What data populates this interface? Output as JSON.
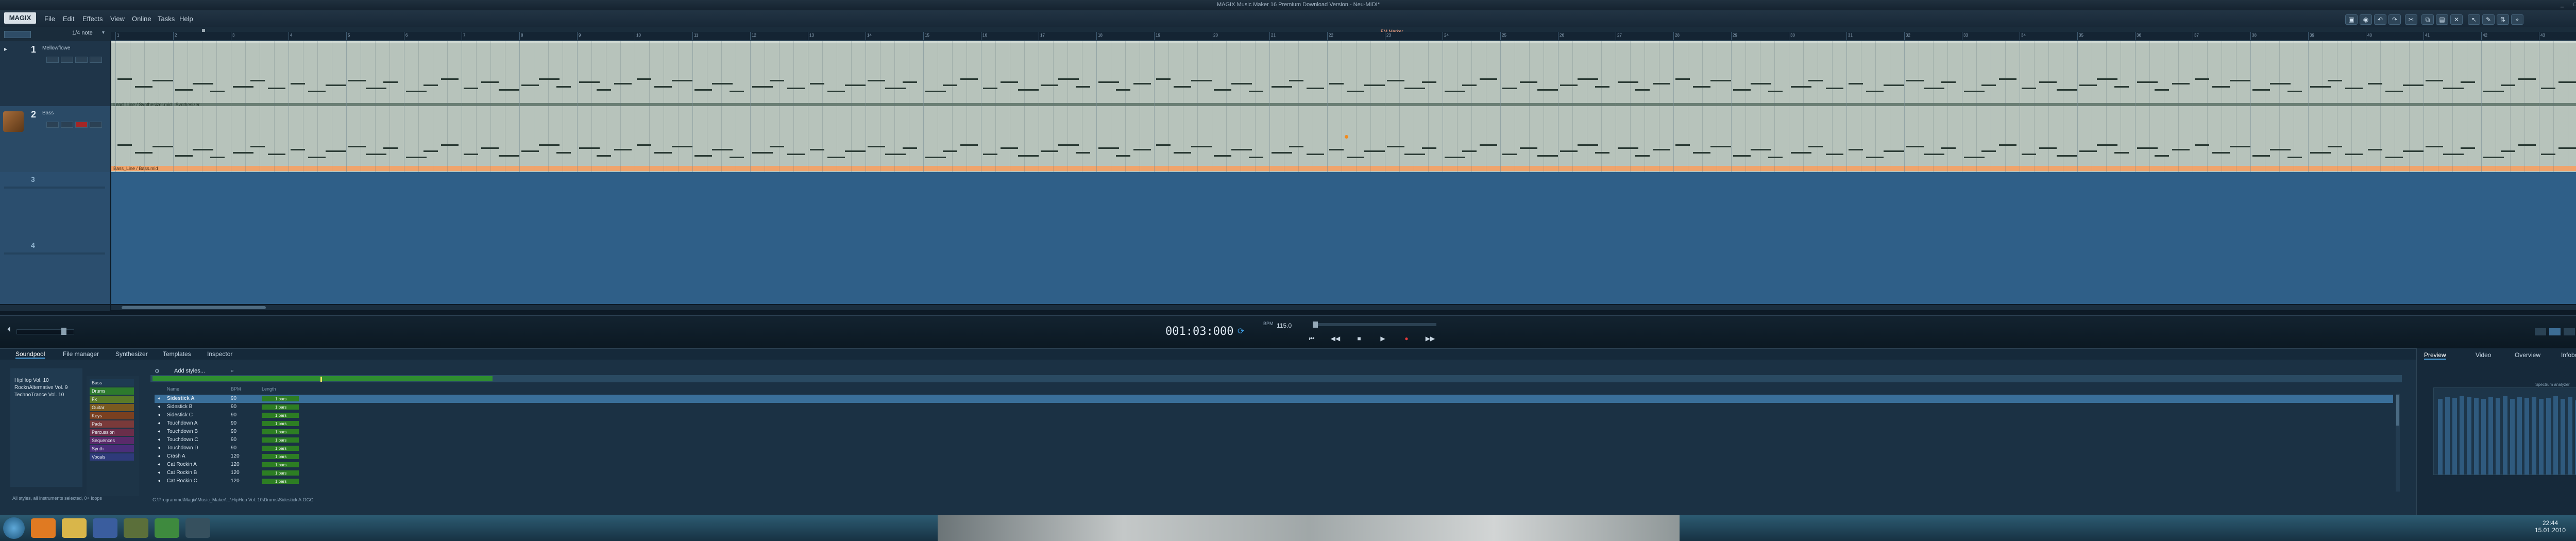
{
  "window": {
    "title": "MAGIX Music Maker 16 Premium Download Version   -   Neu-MIDI*",
    "controls": [
      "_",
      "□",
      "✕"
    ]
  },
  "menubar": {
    "logo": "MAGIX",
    "items": [
      "File",
      "Edit",
      "Effects",
      "View",
      "Online",
      "Tasks",
      "Help"
    ]
  },
  "arranger": {
    "zoom_label": "1/4 note",
    "marker_label": "FM Marker",
    "ruler_start": 1,
    "tracks": [
      {
        "number": "1",
        "name": "Mellowflowe",
        "clip_label": "Lead_Line / Synthesizer.mid / Synthesizer"
      },
      {
        "number": "2",
        "name": "Bass",
        "clip_label": "Bass_Line / Bass.mid"
      },
      {
        "number": "3",
        "name": ""
      },
      {
        "number": "4",
        "name": ""
      }
    ]
  },
  "transport": {
    "time": "001:03:000",
    "bpm": "115.0",
    "buttons": [
      "⏮",
      "◀◀",
      "■",
      "▶",
      "●",
      "▶▶"
    ]
  },
  "mediapool": {
    "tabs": [
      "Soundpool",
      "File manager",
      "Synthesizer",
      "Templates",
      "Inspector"
    ],
    "active_tab": "Soundpool",
    "styles": [
      "HipHop Vol. 10",
      "RocknAlternative Vol. 9",
      "TechnoTrance Vol. 10"
    ],
    "genres": [
      {
        "name": "Bass",
        "color": "#1e3a52"
      },
      {
        "name": "Drums",
        "color": "#2d7a2d"
      },
      {
        "name": "Fx",
        "color": "#5a7a28"
      },
      {
        "name": "Guitar",
        "color": "#7a5a20"
      },
      {
        "name": "Keys",
        "color": "#7a4020"
      },
      {
        "name": "Pads",
        "color": "#7a3a3a"
      },
      {
        "name": "Percussion",
        "color": "#6a2e4a"
      },
      {
        "name": "Sequences",
        "color": "#5a2a6a"
      },
      {
        "name": "Synth",
        "color": "#4a2e7a"
      },
      {
        "name": "Vocals",
        "color": "#2e3a7a"
      }
    ],
    "add_styles_label": "Add styles...",
    "columns": {
      "name": "Name",
      "bpm": "BPM",
      "length": "Length"
    },
    "loops": [
      {
        "name": "Sidestick A",
        "bpm": "90",
        "length": "1 bars"
      },
      {
        "name": "Sidestick B",
        "bpm": "90",
        "length": "1 bars"
      },
      {
        "name": "Sidestick C",
        "bpm": "90",
        "length": "1 bars"
      },
      {
        "name": "Touchdown A",
        "bpm": "90",
        "length": "1 bars"
      },
      {
        "name": "Touchdown B",
        "bpm": "90",
        "length": "1 bars"
      },
      {
        "name": "Touchdown C",
        "bpm": "90",
        "length": "1 bars"
      },
      {
        "name": "Touchdown D",
        "bpm": "90",
        "length": "1 bars"
      },
      {
        "name": "Crash A",
        "bpm": "120",
        "length": "1 bars"
      },
      {
        "name": "Cat Rockin A",
        "bpm": "120",
        "length": "1 bars"
      },
      {
        "name": "Cat Rockin B",
        "bpm": "120",
        "length": "1 bars"
      },
      {
        "name": "Cat Rockin C",
        "bpm": "120",
        "length": "1 bars"
      }
    ],
    "left_status": "All styles, all instruments selected, 0+ loops",
    "status": "C:\\Programme\\Magix\\Music_Maker\\...\\HipHop Vol. 10\\Drums\\Sidestick A.OGG"
  },
  "right_panel": {
    "tabs": [
      "Preview",
      "Video",
      "Overview",
      "Infobox"
    ],
    "active_tab": "Preview",
    "meter_label": "Spectrum analyzer",
    "meter_levels": [
      0.92,
      0.94,
      0.93,
      0.95,
      0.94,
      0.93,
      0.92,
      0.94,
      0.93,
      0.95,
      0.92,
      0.94,
      0.93,
      0.94,
      0.92,
      0.93,
      0.95,
      0.92,
      0.94,
      0.9
    ]
  },
  "taskbar": {
    "clock_time": "22:44",
    "clock_date": "15.01.2010"
  }
}
